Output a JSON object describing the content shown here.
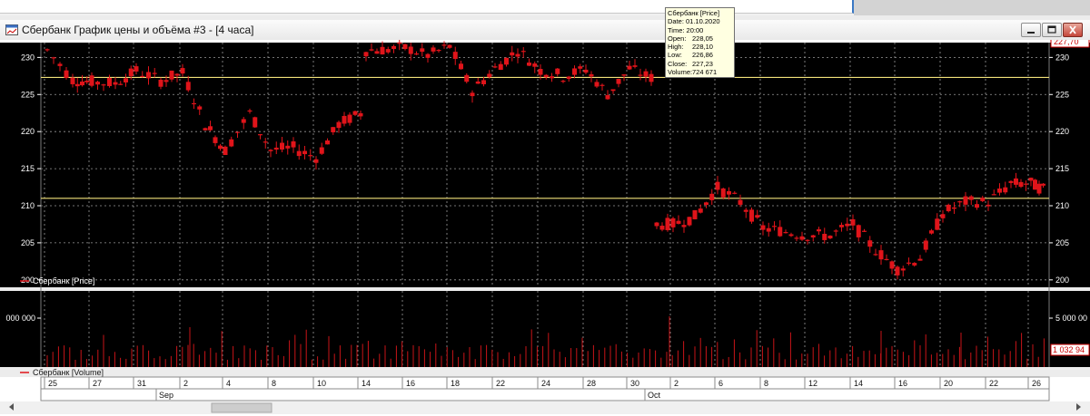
{
  "window": {
    "title": "Сбербанк График цены и объёма #3 - [4 часа]"
  },
  "price_panel": {
    "legend": "Сбербанк [Price]",
    "current_price_label": "227,70",
    "y_ticks": [
      200,
      205,
      210,
      215,
      220,
      225,
      230
    ],
    "horizontal_lines": [
      227.3,
      211.0
    ]
  },
  "volume_panel": {
    "legend": "Сбербанк [Volume]",
    "left_scale_label": "000 000",
    "right_scale_label": "5 000 00",
    "current_volume_label": "1 032 94"
  },
  "time_axis": {
    "day_labels": [
      "25",
      "27",
      "31",
      "2",
      "4",
      "8",
      "10",
      "14",
      "16",
      "18",
      "22",
      "24",
      "28",
      "30",
      "2",
      "6",
      "8",
      "12",
      "14",
      "16",
      "20",
      "22",
      "26"
    ],
    "month_labels": [
      "Sep",
      "Oct"
    ]
  },
  "tooltip": {
    "title": "Сбербанк [Price]",
    "date": "Date: 01.10.2020",
    "time": "Time: 20:00",
    "rows": [
      {
        "key": "Open:",
        "value": "228,05"
      },
      {
        "key": "High:",
        "value": "228,10"
      },
      {
        "key": "Low:",
        "value": "226,86"
      },
      {
        "key": "Close:",
        "value": "227,23"
      },
      {
        "key": "Volume:",
        "value": "724 671"
      }
    ]
  },
  "colors": {
    "background": "#000000",
    "candle": "#e0141a",
    "volume_bar": "#c81418",
    "grid": "#9a9a9a",
    "level_line": "#f2e27a",
    "axis_text": "#ffffff"
  },
  "chart_data": {
    "type": "candlestick",
    "x_unit": "day of month (Aug–Oct 2020)",
    "y_unit": "price",
    "ylim": [
      199,
      232
    ],
    "close_path": [
      [
        "25",
        231
      ],
      [
        "26",
        227
      ],
      [
        "27",
        226.7
      ],
      [
        "28",
        226.5
      ],
      [
        "31",
        228.2
      ],
      [
        "1",
        226.9
      ],
      [
        "2",
        227.9
      ],
      [
        "3",
        221
      ],
      [
        "4",
        217.5
      ],
      [
        "7",
        222.5
      ],
      [
        "8",
        217.5
      ],
      [
        "9",
        217.8
      ],
      [
        "10",
        216.5
      ],
      [
        "11",
        221
      ],
      [
        "14",
        222.5
      ],
      [
        "15",
        231
      ],
      [
        "16",
        231.3
      ],
      [
        "17",
        230.3
      ],
      [
        "18",
        231.5
      ],
      [
        "21",
        225.5
      ],
      [
        "22",
        228.5
      ],
      [
        "23",
        231
      ],
      [
        "24",
        228.3
      ],
      [
        "25",
        227.5
      ],
      [
        "28",
        228.4
      ],
      [
        "29",
        225
      ],
      [
        "30",
        228.5
      ],
      [
        "1",
        227.23
      ],
      [
        "2",
        207.5
      ],
      [
        "5",
        208.5
      ],
      [
        "6",
        212.5
      ],
      [
        "7",
        210.5
      ],
      [
        "8",
        207
      ],
      [
        "9",
        206.5
      ],
      [
        "12",
        206
      ],
      [
        "13",
        206
      ],
      [
        "14",
        207.5
      ],
      [
        "15",
        204
      ],
      [
        "16",
        201.5
      ],
      [
        "19",
        203
      ],
      [
        "20",
        209
      ],
      [
        "21",
        210.5
      ],
      [
        "22",
        210.5
      ],
      [
        "23",
        213
      ],
      [
        "26",
        213
      ],
      [
        "27",
        212
      ]
    ],
    "grid": true,
    "legend_position": "bottom-left"
  }
}
